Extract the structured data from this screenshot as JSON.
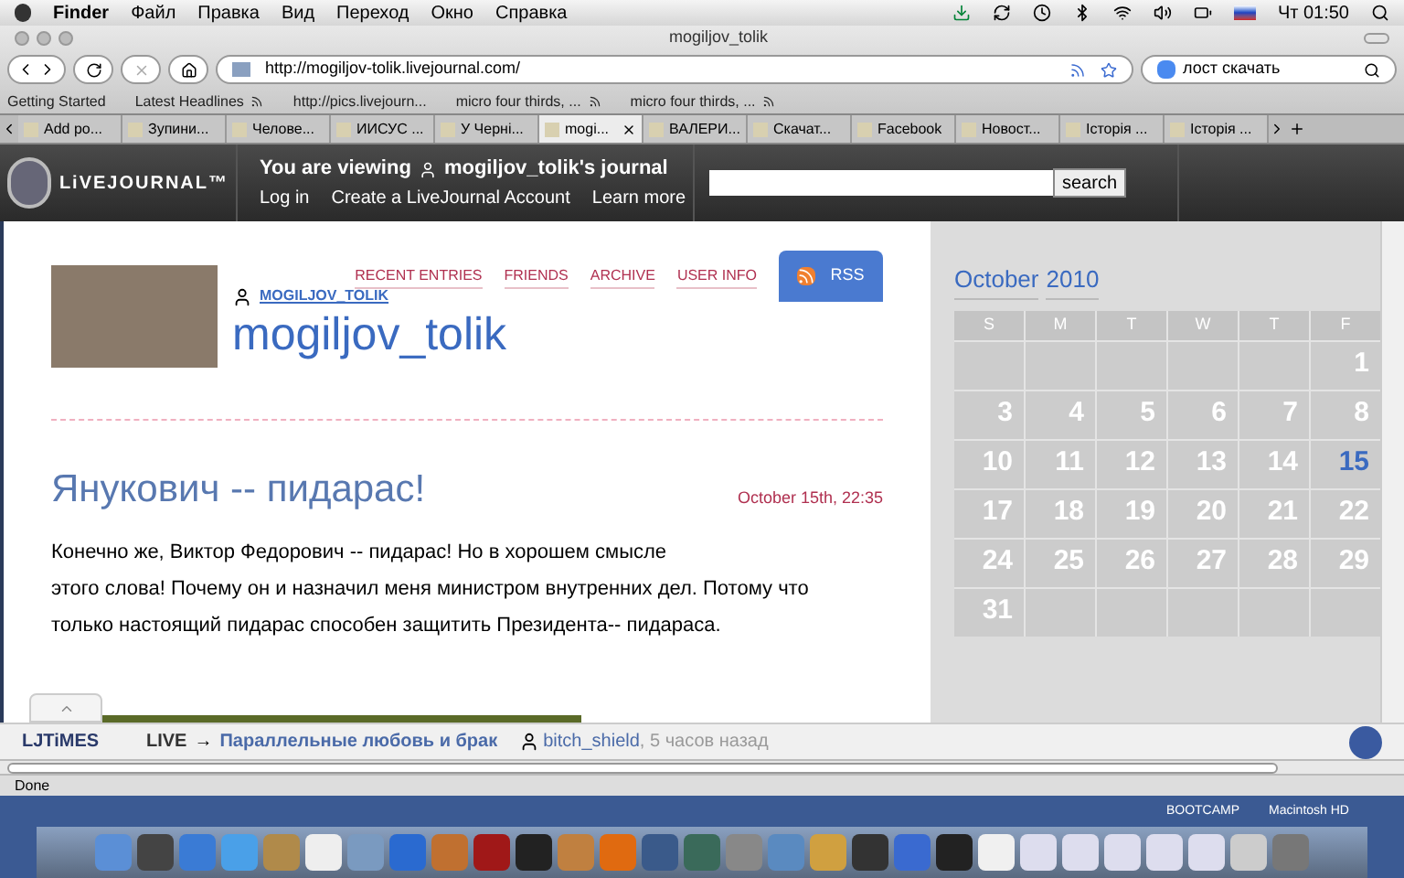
{
  "menubar": {
    "app": "Finder",
    "menus": [
      "Файл",
      "Правка",
      "Вид",
      "Переход",
      "Окно",
      "Справка"
    ],
    "clock": "Чт 01:50"
  },
  "window": {
    "title": "mogiljov_tolik"
  },
  "toolbar": {
    "url": "http://mogiljov-tolik.livejournal.com/",
    "search": "лост скачать"
  },
  "bookmarks": [
    {
      "label": "Getting Started",
      "feed": false
    },
    {
      "label": "Latest Headlines",
      "feed": true
    },
    {
      "label": "http://pics.livejourn...",
      "feed": false
    },
    {
      "label": "micro four thirds, ...",
      "feed": true
    },
    {
      "label": "micro four thirds, ...",
      "feed": true
    }
  ],
  "tabs": [
    {
      "label": "Add po...",
      "selected": false
    },
    {
      "label": "Зупини...",
      "selected": false
    },
    {
      "label": "Челове...",
      "selected": false
    },
    {
      "label": "ИИСУС ...",
      "selected": false
    },
    {
      "label": "У Черні...",
      "selected": false
    },
    {
      "label": "mogi...",
      "selected": true
    },
    {
      "label": "ВАЛЕРИ...",
      "selected": false
    },
    {
      "label": "Скачат...",
      "selected": false
    },
    {
      "label": "Facebook",
      "selected": false
    },
    {
      "label": "Новост...",
      "selected": false
    },
    {
      "label": "Історія ...",
      "selected": false
    },
    {
      "label": "Історія ...",
      "selected": false
    }
  ],
  "lj_header": {
    "logo": "LiVEJOURNAL™",
    "viewing": "You are viewing",
    "user": "mogiljov_tolik's journal",
    "links": [
      "Log in",
      "Create a LiveJournal Account",
      "Learn more"
    ],
    "search_button": "search"
  },
  "journal": {
    "nav": [
      "RECENT ENTRIES",
      "FRIENDS",
      "ARCHIVE",
      "USER INFO"
    ],
    "rss": "RSS",
    "username": "MOGILJOV_TOLIK",
    "title": "mogiljov_tolik"
  },
  "entry": {
    "title": "Янукович -- пидарас!",
    "date": "October 15th, 22:35",
    "lines": [
      "Конечно же, Виктор Федорович -- пидарас! Но в хорошем смысле",
      "этого слова! Почему он и назначил меня министром внутренних дел. Потому что",
      "только настоящий пидарас способен защитить Президента-- пидараса."
    ]
  },
  "calendar": {
    "month": "October",
    "year": "2010",
    "weekdays": [
      "S",
      "M",
      "T",
      "W",
      "T",
      "F"
    ],
    "weeks": [
      [
        {
          "kind": "blank"
        },
        {
          "kind": "blank"
        },
        {
          "kind": "blank"
        },
        {
          "kind": "blank"
        },
        {
          "kind": "blank"
        },
        {
          "kind": "day",
          "day": "1",
          "linked": false
        }
      ],
      [
        {
          "kind": "day",
          "day": "3",
          "linked": false
        },
        {
          "kind": "day",
          "day": "4",
          "linked": false
        },
        {
          "kind": "day",
          "day": "5",
          "linked": false
        },
        {
          "kind": "day",
          "day": "6",
          "linked": false
        },
        {
          "kind": "day",
          "day": "7",
          "linked": false
        },
        {
          "kind": "day",
          "day": "8",
          "linked": false
        }
      ],
      [
        {
          "kind": "day",
          "day": "10",
          "linked": false
        },
        {
          "kind": "day",
          "day": "11",
          "linked": false
        },
        {
          "kind": "day",
          "day": "12",
          "linked": false
        },
        {
          "kind": "day",
          "day": "13",
          "linked": false
        },
        {
          "kind": "day",
          "day": "14",
          "linked": false
        },
        {
          "kind": "day",
          "day": "15",
          "linked": true
        }
      ],
      [
        {
          "kind": "day",
          "day": "17",
          "linked": false
        },
        {
          "kind": "day",
          "day": "18",
          "linked": false
        },
        {
          "kind": "day",
          "day": "19",
          "linked": false
        },
        {
          "kind": "day",
          "day": "20",
          "linked": false
        },
        {
          "kind": "day",
          "day": "21",
          "linked": false
        },
        {
          "kind": "day",
          "day": "22",
          "linked": false
        }
      ],
      [
        {
          "kind": "day",
          "day": "24",
          "linked": false
        },
        {
          "kind": "day",
          "day": "25",
          "linked": false
        },
        {
          "kind": "day",
          "day": "26",
          "linked": false
        },
        {
          "kind": "day",
          "day": "27",
          "linked": false
        },
        {
          "kind": "day",
          "day": "28",
          "linked": false
        },
        {
          "kind": "day",
          "day": "29",
          "linked": false
        }
      ],
      [
        {
          "kind": "day",
          "day": "31",
          "linked": false
        },
        {
          "kind": "blank"
        },
        {
          "kind": "blank"
        },
        {
          "kind": "blank"
        },
        {
          "kind": "blank"
        },
        {
          "kind": "blank"
        }
      ]
    ]
  },
  "ljtimes": {
    "logo": "LJTiMES",
    "live": "LIVE",
    "arrow": "→",
    "headline": "Параллельные любовь и брак",
    "user": "bitch_shield",
    "time": ", 5 часов назад"
  },
  "status_bar": "Done",
  "desktop": {
    "labels": [
      "BOOTCAMP",
      "Macintosh HD"
    ]
  }
}
